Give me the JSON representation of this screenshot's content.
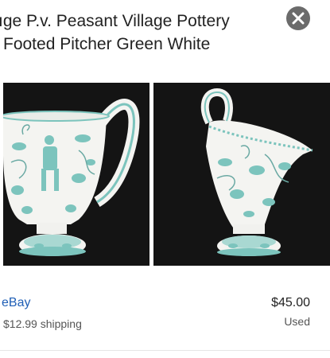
{
  "listing": {
    "title_line1": "ıge P.v. Peasant Village Pottery",
    "title_line2": "Footed Pitcher Green White",
    "source": "eBay",
    "price": "$45.00",
    "shipping": "$12.99 shipping",
    "condition": "Used"
  },
  "icons": {
    "close": "close-icon"
  },
  "colors": {
    "accent_link": "#1f5fb6",
    "glaze_green": "#7cc4bd",
    "photo_background": "#141414"
  }
}
